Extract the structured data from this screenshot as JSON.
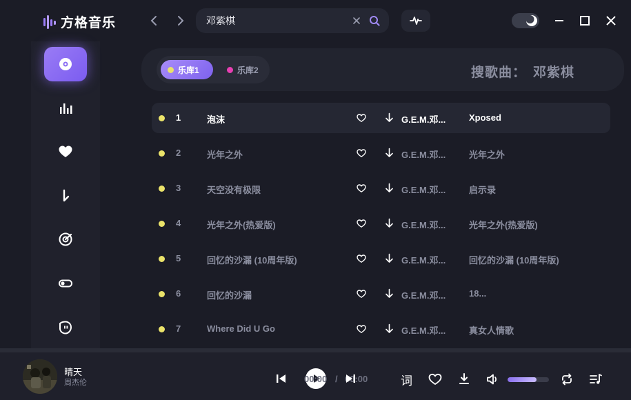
{
  "app": {
    "title": "方格音乐"
  },
  "search": {
    "value": "邓紫棋",
    "clear_icon": "close-icon",
    "submit_icon": "search-icon"
  },
  "library": {
    "tabs": [
      {
        "label": "乐库1",
        "dot_color": "#e9e26b",
        "active": true
      },
      {
        "label": "乐库2",
        "dot_color": "#e83fb3",
        "active": false
      }
    ],
    "search_label": "搜歌曲：",
    "search_keyword": "邓紫棋"
  },
  "sidebar": {
    "items": [
      {
        "icon": "disc-icon",
        "active": true
      },
      {
        "icon": "chart-bars-icon",
        "active": false
      },
      {
        "icon": "heart-icon",
        "active": false
      },
      {
        "icon": "download-icon",
        "active": false
      },
      {
        "icon": "radar-icon",
        "active": false
      },
      {
        "icon": "toggle-icon",
        "active": false
      },
      {
        "icon": "ghost-icon",
        "active": false
      }
    ]
  },
  "songs": [
    {
      "index": "1",
      "title": "泡沫",
      "artist": "G.E.M.邓...",
      "album": "Xposed",
      "current": true
    },
    {
      "index": "2",
      "title": "光年之外",
      "artist": "G.E.M.邓...",
      "album": "光年之外",
      "current": false
    },
    {
      "index": "3",
      "title": "天空没有极限",
      "artist": "G.E.M.邓...",
      "album": "启示录",
      "current": false
    },
    {
      "index": "4",
      "title": "光年之外(热爱版)",
      "artist": "G.E.M.邓...",
      "album": "光年之外(热爱版)",
      "current": false
    },
    {
      "index": "5",
      "title": "回忆的沙漏 (10周年版)",
      "artist": "G.E.M.邓...",
      "album": "回忆的沙漏 (10周年版)",
      "current": false
    },
    {
      "index": "6",
      "title": "回忆的沙漏",
      "artist": "G.E.M.邓...",
      "album": "18...",
      "current": false
    },
    {
      "index": "7",
      "title": "Where Did U Go",
      "artist": "G.E.M.邓...",
      "album": "真女人情歌",
      "current": false
    }
  ],
  "player": {
    "song_title": "晴天",
    "song_artist": "周杰伦",
    "current_time": "00:00",
    "separator": "/",
    "total_time": "00:00",
    "lyric_label": "词",
    "volume_fraction": 0.7
  },
  "colors": {
    "accent": "#8a6ef2",
    "song_dot": "#ebe36a"
  }
}
